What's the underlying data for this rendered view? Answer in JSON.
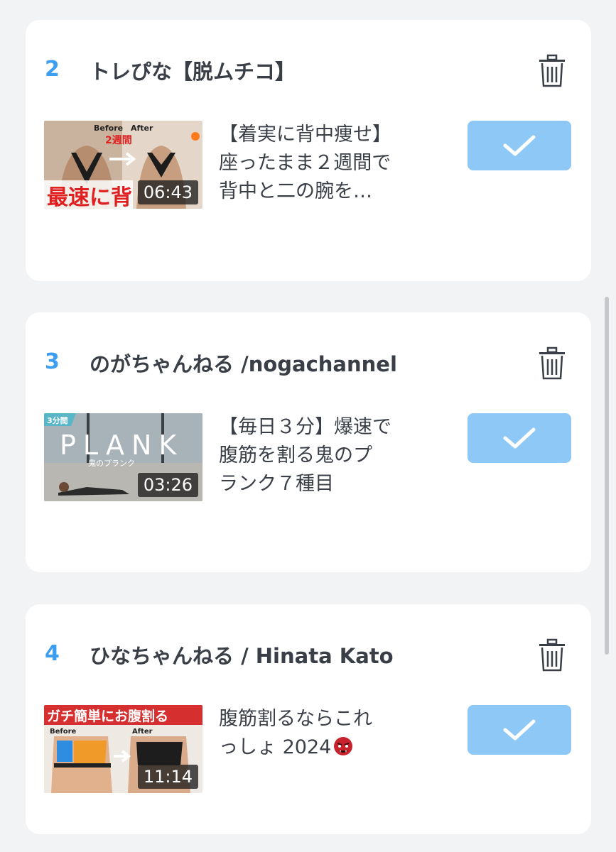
{
  "colors": {
    "accent": "#3d9df0",
    "button": "#8ec8f6",
    "background": "#f2f3f5",
    "card": "#ffffff",
    "text": "#3a3f47"
  },
  "items": [
    {
      "rank": "2",
      "channel": "トレぴな【脱ムチコ】",
      "duration": "06:43",
      "title_lines": [
        "【着実に背中痩せ】",
        "座ったまま２週間で",
        "背中と二の腕を…"
      ],
      "thumb_text": {
        "before": "Before",
        "after": "After",
        "weeks": "2週間",
        "caption": "最速に背"
      },
      "action_icon": "check-icon",
      "delete_icon": "trash-icon"
    },
    {
      "rank": "3",
      "channel": "のがちゃんねる /nogachannel",
      "duration": "03:26",
      "title_lines": [
        "【毎日３分】爆速で",
        "腹筋を割る鬼のプ",
        "ランク７種目"
      ],
      "thumb_text": {
        "badge": "3分間",
        "big": "PLANK",
        "sub": "鬼のプランク"
      },
      "action_icon": "check-icon",
      "delete_icon": "trash-icon"
    },
    {
      "rank": "4",
      "channel": "ひなちゃんねる / Hinata Kato",
      "duration": "11:14",
      "title_lines": [
        "腹筋割るならこれ",
        "っしょ 2024"
      ],
      "title_emoji": "ogre-emoji",
      "thumb_text": {
        "banner": "ガチ簡単にお腹割る",
        "before": "Before",
        "after": "After"
      },
      "action_icon": "check-icon",
      "delete_icon": "trash-icon"
    }
  ]
}
